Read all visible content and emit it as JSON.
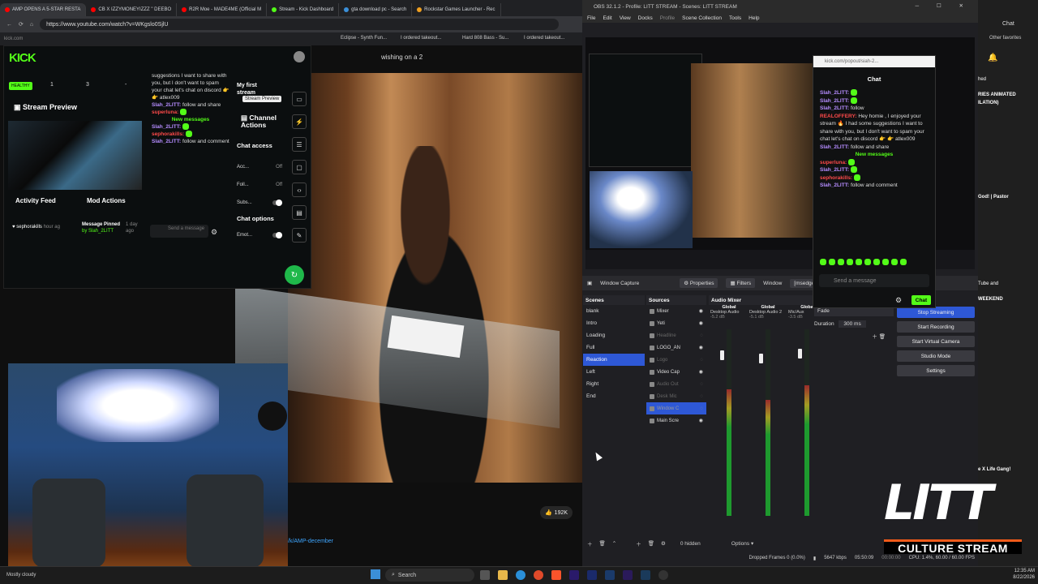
{
  "browser": {
    "tabs": [
      "AMP OPENS A 5-STAR RESTA",
      "CB X IZZYMONEYIZZZ \" DEEBO",
      "R2R Moe - MADE4ME (Official M",
      "Stream - Kick Dashboard",
      "gta download pc - Search",
      "Rockstar Games Launcher - Rec"
    ],
    "url": "https://www.youtube.com/watch?v=WKgslo0SjlU",
    "bookmarks": [
      "Eclipse - Synth Fun...",
      "I ordered takeout...",
      "Hard 808 Bass - Su...",
      "I ordered takeout..."
    ],
    "kick_domain": "kick.com"
  },
  "youtube": {
    "caption": "wishing on a 2",
    "likes": "192K",
    "link": "/k/AMP-december"
  },
  "kick_dashboard": {
    "logo": "KICK",
    "health": "HEALTHY",
    "stats": [
      "1",
      "3",
      "-"
    ],
    "stream_preview_label": "Stream Preview",
    "stream_preview_tooltip": "Stream Preview",
    "activity_feed": "Activity Feed",
    "mod_actions": "Mod Actions",
    "feed_user": "sephorakills",
    "feed_time": "hour ag",
    "message_pinned": "Message Pinned",
    "pinned_by": "by Slah_2LITT",
    "pinned_time": "1 day ago",
    "send_placeholder": "Send a message",
    "my_first_stream": "My first stream",
    "channel_actions": "Channel Actions",
    "chat_access": "Chat access",
    "access_rows": [
      {
        "label": "Acc...",
        "value": "Off"
      },
      {
        "label": "Foll...",
        "value": "Off"
      },
      {
        "label": "Subs...",
        "value": ""
      }
    ],
    "chat_options": "Chat options",
    "emotes_row": "Emot...",
    "chat": [
      {
        "user": "",
        "text": "suggestions I want to share with you, but I don't want to spam your chat let's chat on discord 👉 👉 atlex009"
      },
      {
        "user": "Slah_2LITT:",
        "text": "follow and share"
      },
      {
        "user": "superluna:",
        "text": ""
      },
      {
        "user": "",
        "text": "New messages"
      },
      {
        "user": "Slah_2LITT:",
        "text": ""
      },
      {
        "user": "sephorakills:",
        "text": ""
      },
      {
        "user": "Slah_2LITT:",
        "text": "follow and comment"
      }
    ]
  },
  "obs": {
    "title": "OBS 32.1.2 - Profile: LITT STREAM - Scenes: LITT STREAM",
    "menu": [
      "File",
      "Edit",
      "View",
      "Docks",
      "Profile",
      "Scene Collection",
      "Tools",
      "Help"
    ],
    "source_label": "Window Capture",
    "properties": "Properties",
    "filters": "Filters",
    "window_label": "Window",
    "window_value": "[msedge.exe]:",
    "scenes_header": "Scenes",
    "scenes": [
      "blank",
      "Intro",
      "Loading",
      "Full",
      "Reaction",
      "Left",
      "Right",
      "End"
    ],
    "selected_scene": "Reaction",
    "sources_header": "Sources",
    "sources": [
      {
        "name": "Mixer",
        "dim": false
      },
      {
        "name": "Yeti",
        "dim": false
      },
      {
        "name": "Headline",
        "dim": true
      },
      {
        "name": "LOGO_AN",
        "dim": false
      },
      {
        "name": "Logo",
        "dim": true
      },
      {
        "name": "Video Cap",
        "dim": false
      },
      {
        "name": "Audio Out",
        "dim": true
      },
      {
        "name": "Desk Mic",
        "dim": true
      },
      {
        "name": "Window C",
        "dim": false
      },
      {
        "name": "Main Scre",
        "dim": false
      }
    ],
    "mixer_header": "Audio Mixer",
    "mixer_channels": [
      {
        "group": "Global",
        "name": "Desktop Audio",
        "db": "-5.2 dB",
        "level": 0.68
      },
      {
        "group": "Global",
        "name": "Desktop Audio 2",
        "db": "-5.1 dB",
        "level": 0.62
      },
      {
        "group": "Globa",
        "name": "Mic/Aux",
        "db": "-3.5 dB",
        "level": 0.7
      }
    ],
    "transition": "Fade",
    "duration_label": "Duration",
    "duration_value": "300 ms",
    "controls": [
      "Stop Streaming",
      "Start Recording",
      "Start Virtual Camera",
      "Studio Mode",
      "Settings"
    ],
    "hidden_count": "0 hidden",
    "options": "Options",
    "status": {
      "dropped": "Dropped Frames 0 (0.0%)",
      "kbps": "5647 kbps",
      "stream_time": "05:50:09",
      "rec_time": "00:00:00",
      "cpu": "CPU: 1.4%, 60.00 / 60.00 FPS"
    }
  },
  "chat_popout": {
    "url": "kick.com/popout/siah-2...",
    "title": "Chat",
    "messages": [
      {
        "user": "Slah_2LITT:",
        "text": "",
        "color": "#b58cff"
      },
      {
        "user": "Slah_2LITT:",
        "text": "",
        "color": "#b58cff"
      },
      {
        "user": "Slah_2LITT:",
        "text": "follow",
        "color": "#b58cff"
      },
      {
        "user": "REALOFFERY:",
        "text": "Hey homie , I enjoyed your stream 🔥 I had some suggestions I want to share with you, but I don't want to spam your chat let's chat on discord 👉 👉 atlex009",
        "color": "#ff4a4a"
      },
      {
        "user": "Slah_2LITT:",
        "text": "follow and share",
        "color": "#b58cff"
      },
      {
        "user": "",
        "text": "New messages",
        "color": "#53fc18"
      },
      {
        "user": "superluna:",
        "text": "",
        "color": "#ff4a4a"
      },
      {
        "user": "Slah_2LITT:",
        "text": "",
        "color": "#b58cff"
      },
      {
        "user": "sephorakills:",
        "text": "",
        "color": "#ff4a4a"
      },
      {
        "user": "Slah_2LITT:",
        "text": "follow and comment",
        "color": "#b58cff"
      }
    ],
    "send_placeholder": "Send a message",
    "chat_button": "Chat"
  },
  "right_strip": {
    "chat_label": "Chat",
    "other_favorites": "Other favorites",
    "snippets": [
      "hed",
      "RIES ANIMATED",
      "ILATION)",
      "God! | Pastor",
      "Tube and",
      "WEEKEND",
      "e X Life Gang!"
    ]
  },
  "overlay": {
    "brand": "LITT",
    "tagline": "CULTURE STREAM"
  },
  "taskbar": {
    "weather": "Mostly cloudy",
    "search": "Search",
    "time": "12:35 AM",
    "date": "8/22/2026"
  }
}
